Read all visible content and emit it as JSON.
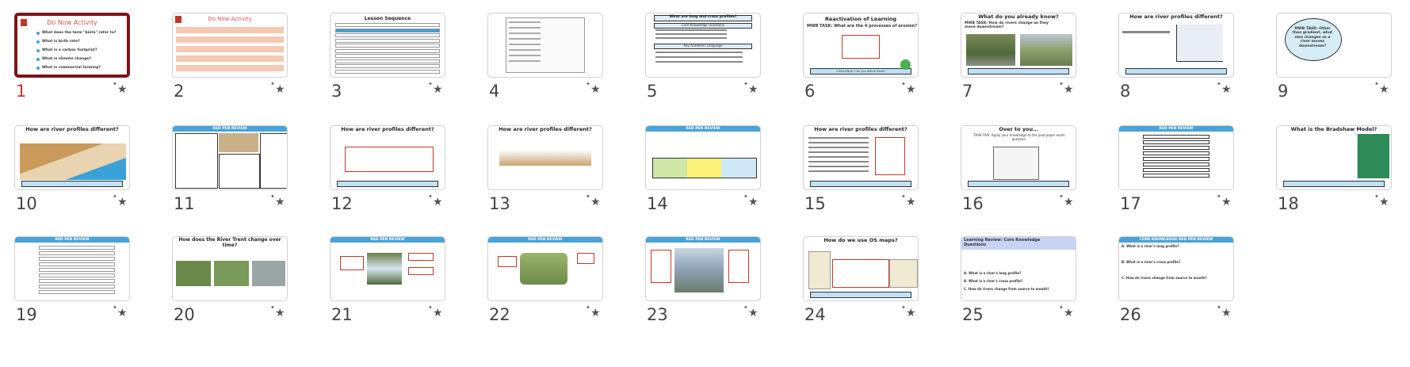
{
  "slides": [
    {
      "number": "1",
      "title": "Do Now Activity",
      "selected": true,
      "questions": [
        "What does the term \"biota\" refer to?",
        "What is birth rate?",
        "What is a carbon footprint?",
        "What is climate change?",
        "What is commercial farming?"
      ]
    },
    {
      "number": "2",
      "title": "Do Now Activity"
    },
    {
      "number": "3",
      "title": "Lesson Sequence"
    },
    {
      "number": "4",
      "title": ""
    },
    {
      "number": "5",
      "title": "What are long and cross profiles?",
      "sub1": "Core Knowledge Questions",
      "sub2": "Key Academic Language"
    },
    {
      "number": "6",
      "title": "Reactivation of Learning",
      "task": "MWB TASK: What are the 4 processes of erosion?",
      "challenge": "CHALLENGE: Can you define them?"
    },
    {
      "number": "7",
      "title": "What do you already know?",
      "task": "MWB TASK: How do rivers change as they move downstream?"
    },
    {
      "number": "8",
      "title": "How are river profiles different?"
    },
    {
      "number": "9",
      "title": "",
      "bubble": "MWB TASK: Other than gradient, what else changes as a river moves downstream?"
    },
    {
      "number": "10",
      "title": "How are river profiles different?"
    },
    {
      "number": "11",
      "title": "RED PEN REVIEW"
    },
    {
      "number": "12",
      "title": "How are river profiles different?"
    },
    {
      "number": "13",
      "title": "How are river profiles different?"
    },
    {
      "number": "14",
      "title": "RED PEN REVIEW"
    },
    {
      "number": "15",
      "title": "How are river profiles different?"
    },
    {
      "number": "16",
      "title": "Over to you…",
      "task": "TASK FIVE: Apply your knowledge to the past paper exam question."
    },
    {
      "number": "17",
      "title": "RED PEN REVIEW"
    },
    {
      "number": "18",
      "title": "What is the Bradshaw Model?"
    },
    {
      "number": "19",
      "title": "RED PEN REVIEW"
    },
    {
      "number": "20",
      "title": "How does the River Trent change over time?"
    },
    {
      "number": "21",
      "title": "RED PEN REVIEW"
    },
    {
      "number": "22",
      "title": "RED PEN REVIEW"
    },
    {
      "number": "23",
      "title": "RED PEN REVIEW"
    },
    {
      "number": "24",
      "title": "How do we use OS maps?"
    },
    {
      "number": "25",
      "title": "Learning Review: Core Knowledge Questions",
      "q1": "A. What is a river's long profile?",
      "q2": "B. What is a river's cross profile?",
      "q3": "C. How do rivers change from source to mouth?"
    },
    {
      "number": "26",
      "title": "CORE KNOWLEDGE RED PEN REVIEW",
      "q1": "A. What is a river's long profile?",
      "q2": "B. What is a river's cross profile?",
      "q3": "C. How do rivers change from source to mouth?"
    }
  ],
  "colors": {
    "selected_border": "#7b1518",
    "red_title": "#d9534f",
    "header_bar": "#4aa3d8",
    "challenge": "#bfe0f5"
  },
  "star_icon": "star-icon"
}
